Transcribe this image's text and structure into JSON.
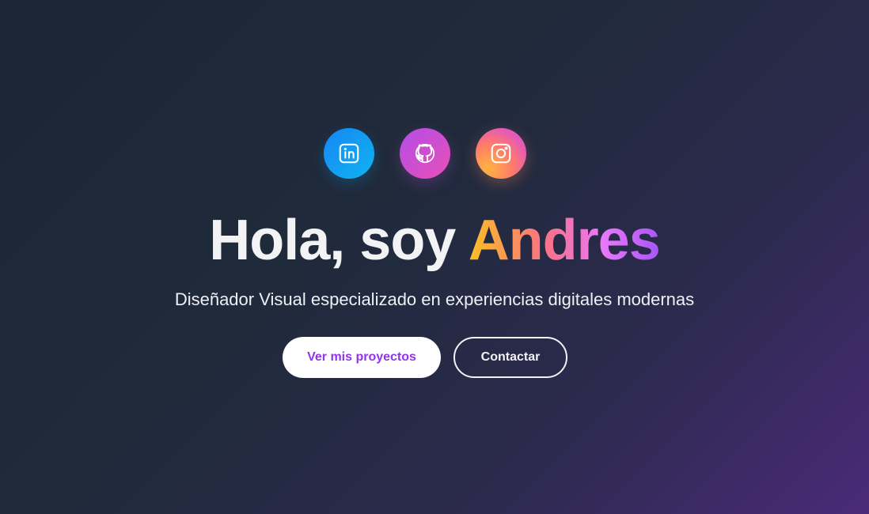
{
  "social_links": [
    {
      "name": "LinkedIn",
      "icon": "linkedin-icon",
      "color": "#1686f3"
    },
    {
      "name": "GitHub",
      "icon": "github-icon",
      "color": "#c94fd6"
    },
    {
      "name": "Instagram",
      "icon": "instagram-icon",
      "color": "#ff7a6a"
    }
  ],
  "hero": {
    "greeting": "Hola, soy ",
    "name": "Andres",
    "subtitle": "Diseñador Visual especializado en experiencias digitales modernas"
  },
  "buttons": {
    "primary_label": "Ver mis proyectos",
    "secondary_label": "Contactar"
  },
  "colors": {
    "accent": "#9333ea",
    "name_gradient": [
      "#fbbf24",
      "#fb7185",
      "#e879f9",
      "#a855f7"
    ]
  }
}
